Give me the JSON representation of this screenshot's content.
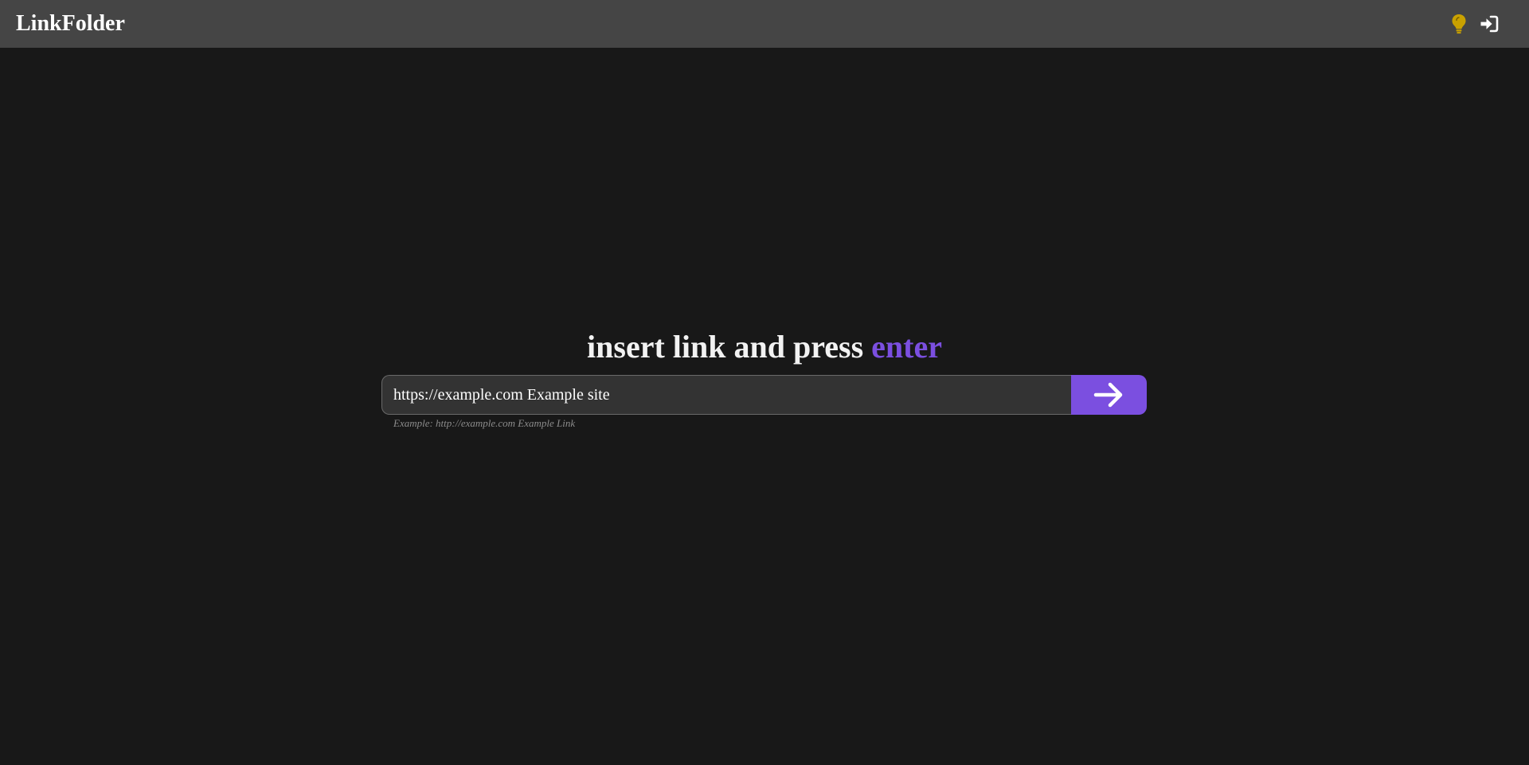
{
  "header": {
    "brand": "LinkFolder",
    "icons": [
      {
        "name": "lightbulb-icon",
        "color": "#c9a100"
      },
      {
        "name": "sign-in-icon",
        "color": "#ffffff"
      }
    ]
  },
  "main": {
    "headline_prefix": "insert link and press ",
    "headline_accent": "enter",
    "input": {
      "value": "https://example.com Example site",
      "placeholder": ""
    },
    "submit_icon": "arrow-right-icon",
    "hint": "Example: http://example.com Example Link"
  },
  "colors": {
    "background": "#181818",
    "navbar": "#454545",
    "accent": "#7b4fe0",
    "input_bg": "#333333"
  }
}
